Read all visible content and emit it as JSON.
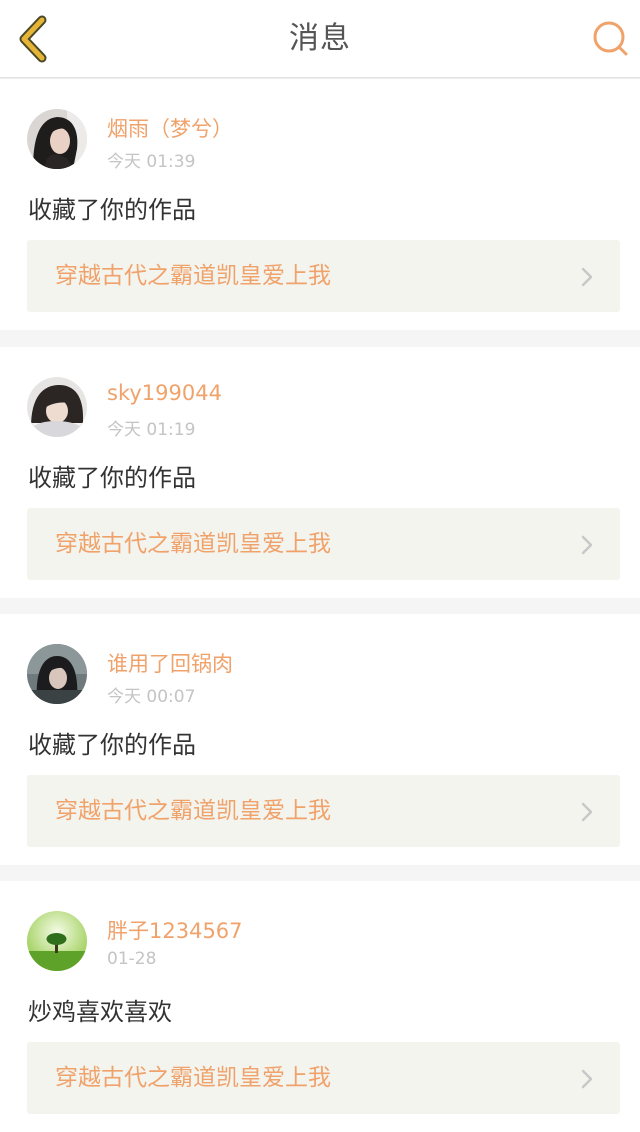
{
  "header": {
    "title": "消息",
    "back_icon": "chevron-left-icon",
    "search_icon": "search-icon",
    "accent_color": "#f0a26b",
    "back_icon_color": "#e7b536"
  },
  "notifications": [
    {
      "username": "烟雨（梦兮）",
      "time": "今天 01:39",
      "message": "收藏了你的作品",
      "work_title": "穿越古代之霸道凯皇爱上我"
    },
    {
      "username": "sky199044",
      "time": "今天 01:19",
      "message": "收藏了你的作品",
      "work_title": "穿越古代之霸道凯皇爱上我"
    },
    {
      "username": "谁用了回锅肉",
      "time": "今天 00:07",
      "message": "收藏了你的作品",
      "work_title": "穿越古代之霸道凯皇爱上我"
    },
    {
      "username": "胖子1234567",
      "time": "01-28",
      "message": "炒鸡喜欢喜欢",
      "work_title": "穿越古代之霸道凯皇爱上我"
    }
  ]
}
